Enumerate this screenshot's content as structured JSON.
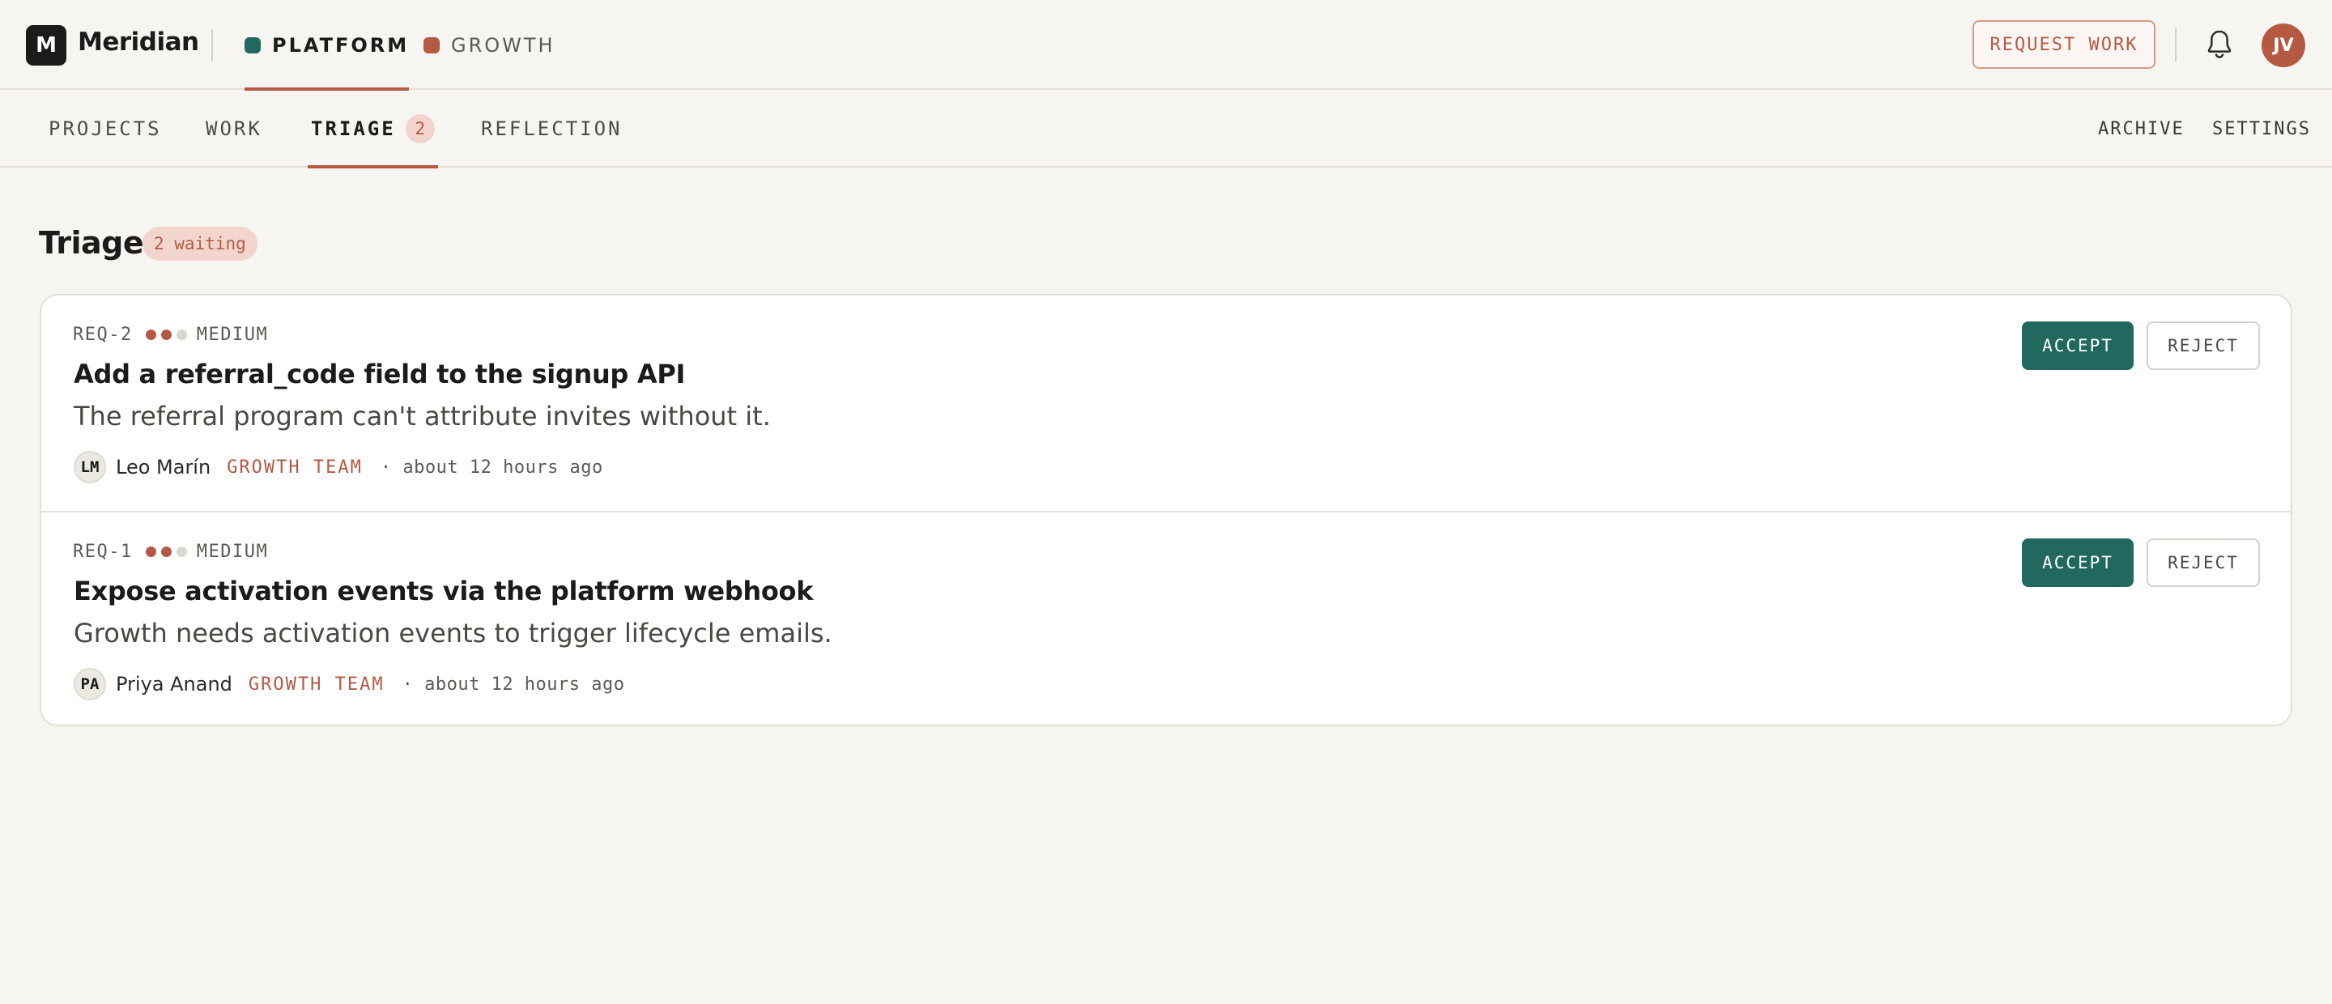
{
  "app": {
    "logo_letter": "M",
    "name": "Meridian"
  },
  "workspaces": [
    {
      "label": "PLATFORM",
      "color": "#21685f",
      "active": true
    },
    {
      "label": "GROWTH",
      "color": "#b45a43",
      "active": false
    }
  ],
  "header": {
    "request_label": "REQUEST WORK",
    "avatar_initials": "JV"
  },
  "subnav": {
    "tabs": [
      {
        "label": "PROJECTS"
      },
      {
        "label": "WORK"
      },
      {
        "label": "TRIAGE",
        "count": "2",
        "active": true
      },
      {
        "label": "REFLECTION"
      }
    ],
    "right": [
      {
        "label": "ARCHIVE"
      },
      {
        "label": "SETTINGS"
      }
    ]
  },
  "page": {
    "title": "Triage",
    "badge": "2 waiting"
  },
  "requests": [
    {
      "id": "REQ-2",
      "priority": "MEDIUM",
      "priority_level": 2,
      "title": "Add a referral_code field to the signup API",
      "description": "The referral program can't attribute invites without it.",
      "author_initials": "LM",
      "author_name": "Leo Marín",
      "team": "GROWTH TEAM",
      "time": "· about 12 hours ago",
      "accept_label": "ACCEPT",
      "reject_label": "REJECT"
    },
    {
      "id": "REQ-1",
      "priority": "MEDIUM",
      "priority_level": 2,
      "title": "Expose activation events via the platform webhook",
      "description": "Growth needs activation events to trigger lifecycle emails.",
      "author_initials": "PA",
      "author_name": "Priya Anand",
      "team": "GROWTH TEAM",
      "time": "· about 12 hours ago",
      "accept_label": "ACCEPT",
      "reject_label": "REJECT"
    }
  ],
  "colors": {
    "accent": "#b45a43",
    "accept": "#21685f",
    "priority_dot_on": "#b45a43",
    "priority_dot_off": "#d9d6d0"
  }
}
